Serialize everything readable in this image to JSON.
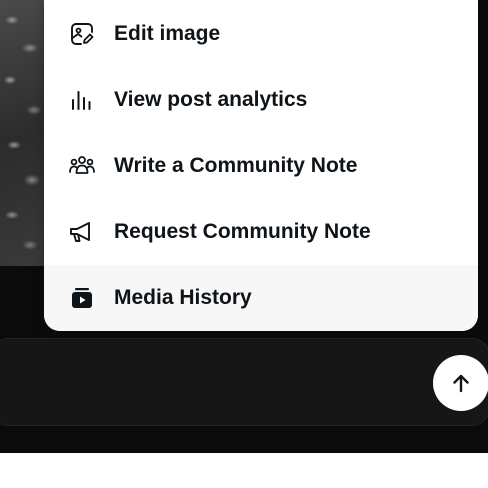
{
  "menu": {
    "items": [
      {
        "label": "Edit image",
        "icon": "edit-image-icon"
      },
      {
        "label": "View post analytics",
        "icon": "analytics-icon"
      },
      {
        "label": "Write a Community Note",
        "icon": "community-icon"
      },
      {
        "label": "Request Community Note",
        "icon": "megaphone-icon"
      },
      {
        "label": "Media History",
        "icon": "media-history-icon"
      }
    ]
  },
  "composer": {
    "send_icon": "arrow-up-icon"
  },
  "colors": {
    "text": "#0f1419",
    "menu_bg": "#ffffff",
    "hover_bg": "#f7f7f7",
    "composer_bg": "#161616"
  }
}
